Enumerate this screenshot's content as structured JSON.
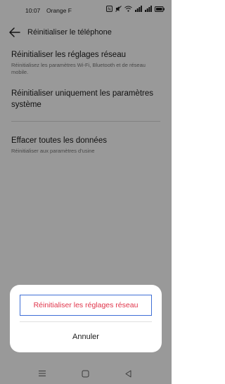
{
  "status_bar": {
    "time": "10:07",
    "carrier": "Orange F"
  },
  "header": {
    "title": "Réinitialiser le téléphone"
  },
  "settings": [
    {
      "title": "Réinitialiser les réglages réseau",
      "subtitle": "Réinitialisez les paramètres Wi-Fi, Bluetooth et de réseau mobile."
    },
    {
      "title": "Réinitialiser uniquement les paramètres système",
      "subtitle": ""
    },
    {
      "title": "Effacer toutes les données",
      "subtitle": "Réinitialiser aux paramètres d'usine"
    }
  ],
  "dialog": {
    "confirm_label": "Réinitialiser les réglages réseau",
    "cancel_label": "Annuler"
  },
  "colors": {
    "accent_destructive": "#e0344a",
    "highlight_border": "#3f6fd6",
    "scrim": "rgba(0,0,0,0.40)"
  },
  "icons": {
    "back": "arrow-left-icon",
    "nav": [
      "menu-icon",
      "home-square-icon",
      "back-triangle-icon"
    ],
    "status": [
      "nfc-icon",
      "mute-icon",
      "wifi-icon",
      "signal-icon",
      "signal-icon",
      "battery-icon"
    ]
  }
}
